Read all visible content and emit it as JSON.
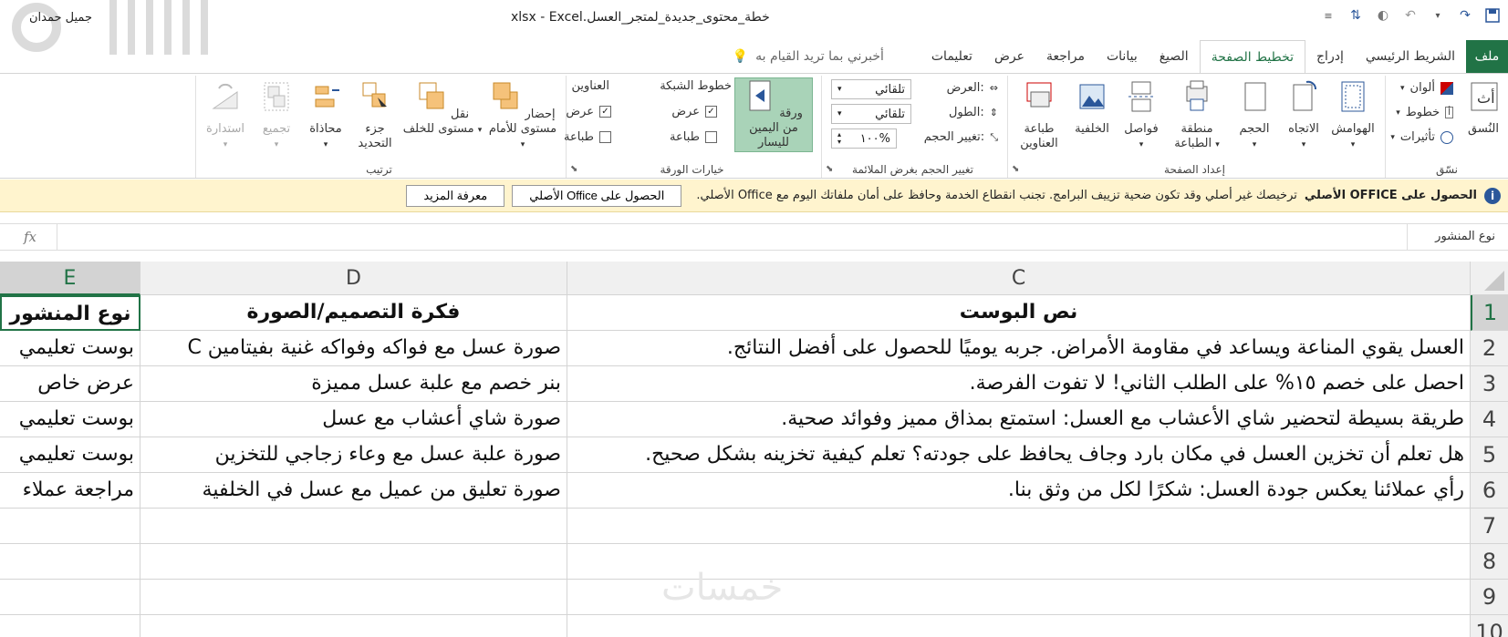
{
  "titlebar": {
    "title": "خطة_محتوى_جديدة_لمتجر_العسل.xlsx  -  Excel",
    "user": "جميل حمدان"
  },
  "tabs": {
    "file": "ملف",
    "items": [
      "الشريط الرئيسي",
      "إدراج",
      "تخطيط الصفحة",
      "الصيغ",
      "بيانات",
      "مراجعة",
      "عرض",
      "تعليمات"
    ],
    "active": "تخطيط الصفحة",
    "tell_me": "أخبرني بما تريد القيام به"
  },
  "ribbon": {
    "themes": {
      "group_label": "نسّق",
      "themes_btn": "النُسق",
      "colors": "ألوان",
      "fonts": "خطوط",
      "effects": "تأثيرات"
    },
    "page_setup": {
      "group_label": "إعداد الصفحة",
      "margins": "الهوامش",
      "orientation": "الاتجاه",
      "size": "الحجم",
      "print_area": "منطقة الطباعة",
      "breaks": "فواصل",
      "background": "الخلفية",
      "print_titles": "طباعة العناوين"
    },
    "scale": {
      "group_label": "تغيير الحجم بغرض الملائمة",
      "width_label": "العرض:",
      "width_value": "تلقائي",
      "height_label": "الطول:",
      "height_value": "تلقائي",
      "scale_label": "تغيير الحجم:",
      "scale_value": "١٠٠%"
    },
    "sheet_options": {
      "group_label": "خيارات الورقة",
      "sheet_rtl": "ورقة من اليمين لليسار",
      "gridlines": "خطوط الشبكة",
      "headings": "العناوين",
      "view": "عرض",
      "print": "طباعة"
    },
    "arrange": {
      "group_label": "ترتيب",
      "bring_forward": "إحضار مستوى للأمام",
      "send_backward": "نقل مستوى للخلف",
      "selection_pane": "جزء التحديد",
      "align": "محاذاة",
      "group": "تجميع",
      "rotate": "استدارة"
    }
  },
  "message_bar": {
    "title": "الحصول على OFFICE الأصلي",
    "text": "ترخيصك غير أصلي وقد تكون ضحية تزييف البرامج. تجنب انقطاع الخدمة وحافظ على أمان ملفاتك اليوم مع Office الأصلي.",
    "btn_get": "الحصول على Office الأصلي",
    "btn_learn": "معرفة المزيد"
  },
  "formula_bar": {
    "name_box": "نوع المنشور",
    "fx": "fx"
  },
  "sheet": {
    "columns": [
      "C",
      "D",
      "E"
    ],
    "row_numbers": [
      "1",
      "2",
      "3",
      "4",
      "5",
      "6",
      "7",
      "8",
      "9",
      "10"
    ],
    "header": [
      "نص البوست",
      "فكرة التصميم/الصورة",
      "نوع المنشور"
    ],
    "rows": [
      [
        "العسل يقوي المناعة ويساعد في مقاومة الأمراض. جربه يوميًا للحصول على أفضل النتائج.",
        "صورة عسل مع فواكه وفواكه غنية بفيتامين C",
        "بوست تعليمي"
      ],
      [
        "احصل على خصم ١٥% على الطلب الثاني! لا تفوت الفرصة.",
        "بنر خصم مع علبة عسل مميزة",
        "عرض خاص"
      ],
      [
        "طريقة بسيطة لتحضير شاي الأعشاب مع العسل: استمتع بمذاق مميز وفوائد صحية.",
        "صورة شاي أعشاب مع عسل",
        "بوست تعليمي"
      ],
      [
        "هل تعلم أن تخزين العسل في مكان بارد وجاف يحافظ على جودته؟ تعلم كيفية تخزينه بشكل صحيح.",
        "صورة علبة عسل مع وعاء زجاجي للتخزين",
        "بوست تعليمي"
      ],
      [
        "رأي عملائنا يعكس جودة العسل: شكرًا لكل من وثق بنا.",
        "صورة تعليق من عميل مع عسل في الخلفية",
        "مراجعة عملاء"
      ]
    ]
  },
  "watermark": "خمسات",
  "colors": {
    "accent": "#217346",
    "ribbon_highlight": "#a9d3b8",
    "msgbar": "#fff4ce"
  }
}
